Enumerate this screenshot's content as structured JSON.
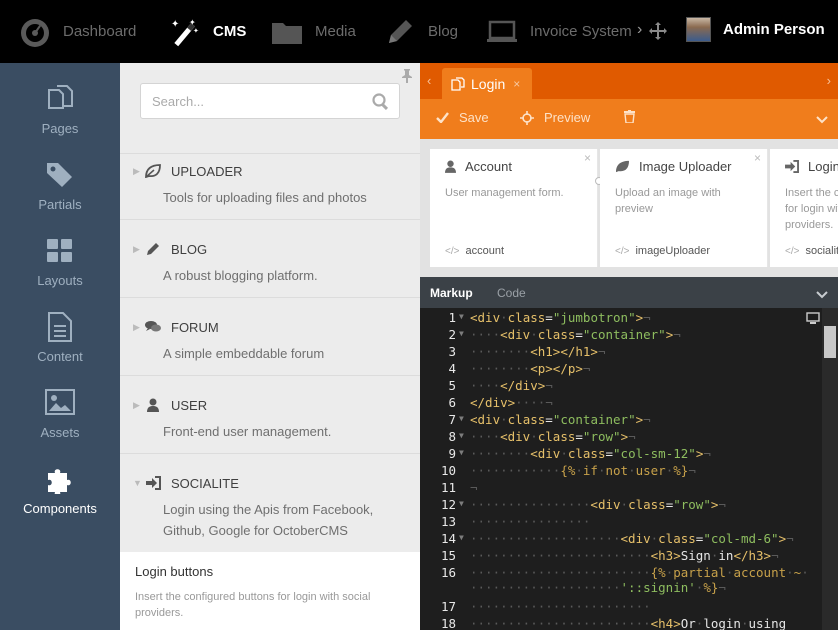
{
  "topnav": {
    "items": [
      {
        "label": "Dashboard",
        "icon": "dashboard-gauge-icon"
      },
      {
        "label": "CMS",
        "icon": "magic-wand-icon",
        "active": true
      },
      {
        "label": "Media",
        "icon": "folder-icon"
      },
      {
        "label": "Blog",
        "icon": "pencil-icon"
      },
      {
        "label": "Invoice System",
        "icon": "laptop-icon"
      }
    ],
    "overflow": "›",
    "user": {
      "name": "Admin Person"
    }
  },
  "sidebar": {
    "items": [
      {
        "label": "Pages",
        "icon": "pages-icon"
      },
      {
        "label": "Partials",
        "icon": "tags-icon"
      },
      {
        "label": "Layouts",
        "icon": "layouts-grid-icon"
      },
      {
        "label": "Content",
        "icon": "file-icon"
      },
      {
        "label": "Assets",
        "icon": "image-icon"
      },
      {
        "label": "Components",
        "icon": "puzzle-icon",
        "active": true
      }
    ]
  },
  "panel": {
    "search_placeholder": "Search...",
    "groups": [
      {
        "title": "UPLOADER",
        "desc": "Tools for uploading files and photos",
        "icon": "leaf-icon",
        "expanded": false
      },
      {
        "title": "BLOG",
        "desc": "A robust blogging platform.",
        "icon": "pencil-icon",
        "expanded": false
      },
      {
        "title": "FORUM",
        "desc": "A simple embeddable forum",
        "icon": "comments-icon",
        "expanded": false
      },
      {
        "title": "USER",
        "desc": "Front-end user management.",
        "icon": "user-icon",
        "expanded": false
      },
      {
        "title": "SOCIALITE",
        "desc": "Login using the Apis from Facebook, Github, Google for OctoberCMS",
        "icon": "sign-in-icon",
        "expanded": true
      }
    ],
    "component": {
      "title": "Login buttons",
      "desc": "Insert the configured buttons for login with social providers."
    }
  },
  "editor": {
    "tab": {
      "label": "Login",
      "close": "×"
    },
    "toolbar": {
      "save": "Save",
      "preview": "Preview"
    },
    "cards": [
      {
        "title": "Account",
        "desc": "User management form.",
        "alias": "account",
        "icon": "user-icon"
      },
      {
        "title": "Image Uploader",
        "desc": "Upload an image with preview",
        "alias": "imageUploader",
        "icon": "leaf-icon"
      },
      {
        "title": "Login buttons",
        "desc": "Insert the configured buttons for login with social providers.",
        "alias": "socialite",
        "icon": "sign-in-icon"
      }
    ],
    "code_tabs": {
      "markup": "Markup",
      "code": "Code"
    },
    "code_lines": [
      {
        "n": "1",
        "fold": true
      },
      {
        "n": "2",
        "fold": true
      },
      {
        "n": "3",
        "fold": false
      },
      {
        "n": "4",
        "fold": false
      },
      {
        "n": "5",
        "fold": false
      },
      {
        "n": "6",
        "fold": false
      },
      {
        "n": "7",
        "fold": true
      },
      {
        "n": "8",
        "fold": true
      },
      {
        "n": "9",
        "fold": true
      },
      {
        "n": "10",
        "fold": false
      },
      {
        "n": "11",
        "fold": false
      },
      {
        "n": "12",
        "fold": true
      },
      {
        "n": "13",
        "fold": false
      },
      {
        "n": "14",
        "fold": true
      },
      {
        "n": "15",
        "fold": false
      },
      {
        "n": "16",
        "fold": false
      },
      {
        "n": "17",
        "fold": false
      },
      {
        "n": "18",
        "fold": false
      }
    ]
  },
  "colors": {
    "accent": "#f07d1c",
    "accent_dark": "#e05a00",
    "sidebar": "#3a4d62"
  }
}
